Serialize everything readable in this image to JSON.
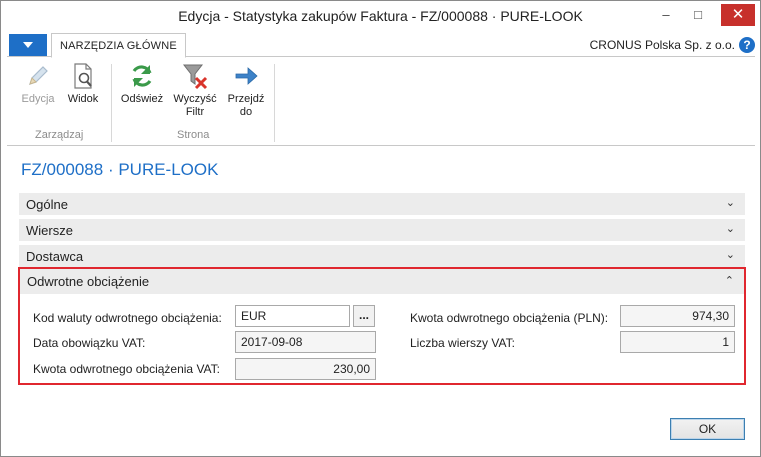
{
  "window": {
    "title": "Edycja - Statystyka zakupów Faktura - FZ/000088 · PURE-LOOK",
    "min_glyph": "–",
    "max_glyph": "□",
    "close_glyph": "✕"
  },
  "ribbon_bar": {
    "tab_label": "NARZĘDZIA GŁÓWNE",
    "company": "CRONUS Polska Sp. z o.o.",
    "help_glyph": "?"
  },
  "ribbon": {
    "groups": [
      {
        "label": "Zarządzaj",
        "buttons": [
          {
            "label": "Edycja",
            "icon": "pencil-icon",
            "enabled": false
          },
          {
            "label": "Widok",
            "icon": "document-view-icon",
            "enabled": true
          }
        ]
      },
      {
        "label": "Strona",
        "buttons": [
          {
            "label": "Odśwież",
            "icon": "refresh-icon",
            "enabled": true
          },
          {
            "label": "Wyczyść Filtr",
            "icon": "clear-filter-icon",
            "enabled": true
          },
          {
            "label": "Przejdź do",
            "icon": "arrow-right-icon",
            "enabled": true
          }
        ]
      }
    ],
    "edit_label": "Edycja",
    "view_label": "Widok",
    "refresh_label": "Odśwież",
    "clear_filter_line1": "Wyczyść",
    "clear_filter_line2": "Filtr",
    "goto_line1": "Przejdź",
    "goto_line2": "do",
    "group1_label": "Zarządzaj",
    "group2_label": "Strona"
  },
  "page": {
    "title": "FZ/000088 · PURE-LOOK"
  },
  "fasttabs": {
    "general": "Ogólne",
    "lines": "Wiersze",
    "vendor": "Dostawca",
    "reverse_charge": "Odwrotne obciążenie",
    "collapsed_chevron": "⌄",
    "expanded_chevron": "⌃"
  },
  "reverse_charge": {
    "currency_code_label": "Kod waluty odwrotnego obciążenia:",
    "currency_code_value": "EUR",
    "ellipsis_label": "...",
    "vat_date_label": "Data obowiązku VAT:",
    "vat_date_value": "2017-09-08",
    "vat_amount_label": "Kwota odwrotnego obciążenia VAT:",
    "vat_amount_value": "230,00",
    "amount_pln_label": "Kwota odwrotnego obciążenia (PLN):",
    "amount_pln_value": "974,30",
    "vat_lines_label": "Liczba wierszy VAT:",
    "vat_lines_value": "1"
  },
  "footer": {
    "ok_label": "OK"
  },
  "colors": {
    "accent": "#1e6fc7",
    "highlight_border": "#e0272f",
    "close_button": "#c7302b",
    "fasttab_bg": "#ececec"
  }
}
